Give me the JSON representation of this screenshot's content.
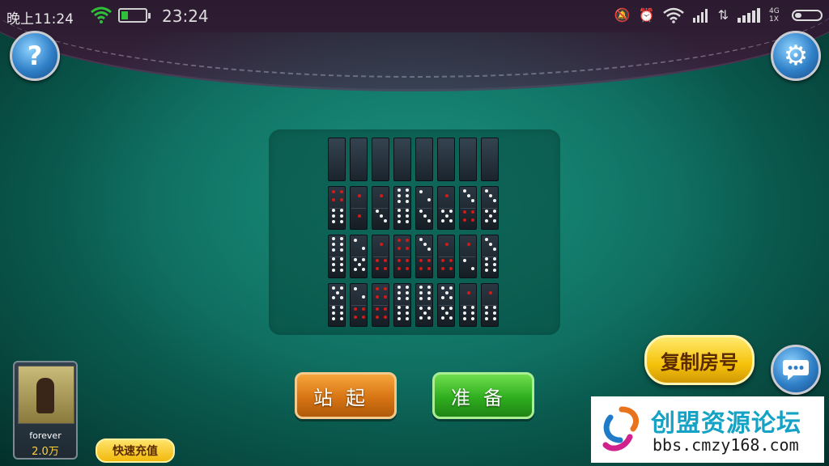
{
  "status_bar": {
    "time": "晚上11:24",
    "clock": "23:24",
    "network_label": "4G 1X"
  },
  "buttons": {
    "help_label": "?",
    "settings_label": "⚙",
    "stand_label": "站起",
    "ready_label": "准备",
    "copy_room_label": "复制房号",
    "recharge_label": "快速充值"
  },
  "player": {
    "name": "forever",
    "coins": "2.0万"
  },
  "watermark": {
    "title": "创盟资源论坛",
    "url": "bbs.cmzy168.com"
  },
  "colors": {
    "felt": "#0d6a5c",
    "stand_button": "#d77414",
    "ready_button": "#2fae1f",
    "copy_button": "#f6c20a"
  }
}
